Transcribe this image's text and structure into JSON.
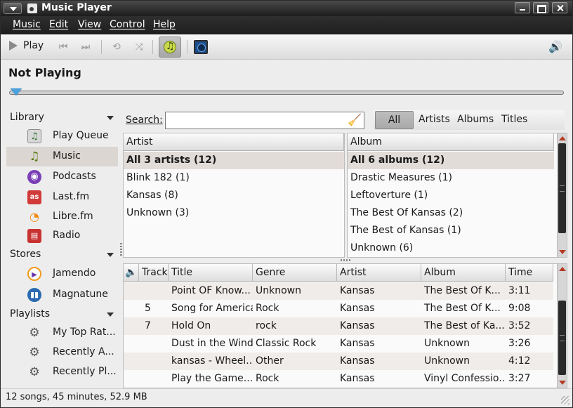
{
  "window": {
    "title": "Music Player"
  },
  "menubar": [
    "Music",
    "Edit",
    "View",
    "Control",
    "Help"
  ],
  "toolbar": {
    "play_label": "Play"
  },
  "now_playing": "Not Playing",
  "seek": {
    "position": 0
  },
  "sidebar": {
    "library_header": "Library",
    "library_items": [
      "Play Queue",
      "Music",
      "Podcasts",
      "Last.fm",
      "Libre.fm",
      "Radio"
    ],
    "stores_header": "Stores",
    "stores_items": [
      "Jamendo",
      "Magnatune"
    ],
    "playlists_header": "Playlists",
    "playlists_items": [
      "My Top Rat...",
      "Recently A...",
      "Recently Pl..."
    ],
    "selected": "Music"
  },
  "search": {
    "label": "Search:",
    "value": "",
    "placeholder": ""
  },
  "filter": {
    "options": [
      "All",
      "Artists",
      "Albums",
      "Titles"
    ],
    "selected": "All"
  },
  "artist_pane": {
    "header": "Artist",
    "rows": [
      "All 3 artists (12)",
      "Blink 182 (1)",
      "Kansas (8)",
      "Unknown (3)"
    ]
  },
  "album_pane": {
    "header": "Album",
    "rows": [
      "All 6 albums (12)",
      "Drastic Measures (1)",
      "Leftoverture (1)",
      "The Best Of Kansas (2)",
      "The Best of Kansas (1)",
      "Unknown (6)"
    ]
  },
  "tracks": {
    "columns": [
      "Track",
      "Title",
      "Genre",
      "Artist",
      "Album",
      "Time"
    ],
    "rows": [
      {
        "track": "",
        "title": "Point OF Know...",
        "genre": "Unknown",
        "artist": "Kansas",
        "album": "The Best Of K...",
        "time": "3:11"
      },
      {
        "track": "5",
        "title": "Song for America",
        "genre": "Rock",
        "artist": "Kansas",
        "album": "The Best Of K...",
        "time": "9:08"
      },
      {
        "track": "7",
        "title": "Hold On",
        "genre": "rock",
        "artist": "Kansas",
        "album": "The Best of Ka...",
        "time": "3:52"
      },
      {
        "track": "",
        "title": "Dust in the Wind",
        "genre": "Classic Rock",
        "artist": "Kansas",
        "album": "Unknown",
        "time": "3:26"
      },
      {
        "track": "",
        "title": "kansas - Wheel...",
        "genre": "Other",
        "artist": "Kansas",
        "album": "Unknown",
        "time": "4:12"
      },
      {
        "track": "",
        "title": "Play the Game...",
        "genre": "Rock",
        "artist": "Kansas",
        "album": "Vinyl Confessio...",
        "time": "3:27"
      }
    ]
  },
  "status": "12 songs, 45 minutes, 52.9 MB",
  "colors": {
    "accent": "#4aa3e0",
    "selection": "#dcd6d2",
    "menubar": "#1e1e1e"
  }
}
